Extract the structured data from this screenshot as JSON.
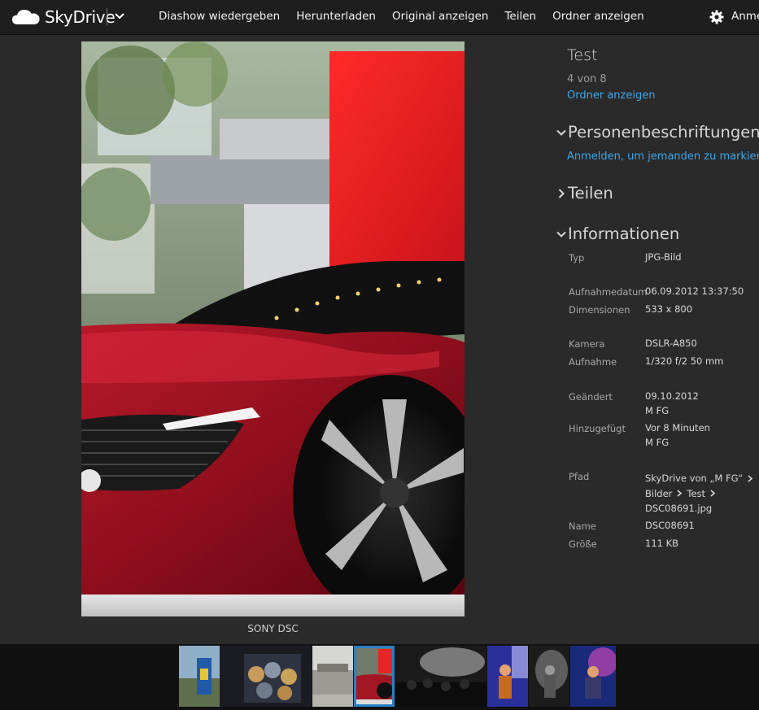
{
  "app": {
    "name": "SkyDrive"
  },
  "toolbar": {
    "items": [
      "Diashow wiedergeben",
      "Herunterladen",
      "Original anzeigen",
      "Teilen",
      "Ordner anzeigen"
    ],
    "signin": "Anme"
  },
  "photo": {
    "caption": "SONY DSC"
  },
  "details": {
    "title": "Test",
    "position": "4 von 8",
    "folder_link": "Ordner anzeigen",
    "tags_heading": "Personenbeschriftungen",
    "tags_link": "Anmelden, um jemanden zu markieren",
    "share_heading": "Teilen",
    "info_heading": "Informationen",
    "info": {
      "type_label": "Typ",
      "type_value": "JPG-Bild",
      "date_label": "Aufnahmedatum",
      "date_value": "06.09.2012 13:37:50",
      "dim_label": "Dimensionen",
      "dim_value": "533 x 800",
      "camera_label": "Kamera",
      "camera_value": "DSLR-A850",
      "shot_label": "Aufnahme",
      "shot_value": "1/320 f/2 50 mm",
      "changed_label": "Geändert",
      "changed_date": "09.10.2012",
      "changed_by": "M FG",
      "added_label": "Hinzugefügt",
      "added_date": "Vor 8 Minuten",
      "added_by": "M FG",
      "path_label": "Pfad",
      "path_root": "SkyDrive von „M FG“",
      "path_folder1": "Bilder",
      "path_folder2": "Test",
      "path_file": "DSC08691.jpg",
      "name_label": "Name",
      "name_value": "DSC08691",
      "size_label": "Größe",
      "size_value": "111 KB"
    }
  },
  "filmstrip": {
    "selected_index": 3,
    "count": 8
  }
}
